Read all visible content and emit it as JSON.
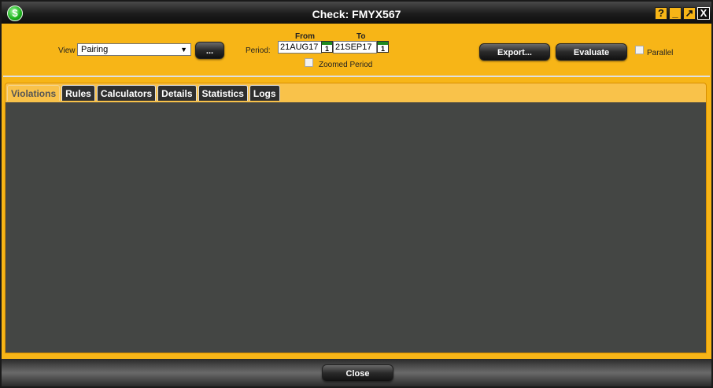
{
  "window": {
    "title": "Check: FMYX567",
    "app_icon": "dollar-icon",
    "controls": [
      "help-icon",
      "minimize-icon",
      "maximize-icon",
      "close-icon"
    ],
    "control_glyphs": {
      "help": "?",
      "minimize": "_",
      "maximize": "↗",
      "close": "X"
    }
  },
  "toolbar": {
    "view_label": "View",
    "view_value": "Pairing",
    "ellipsis_label": "...",
    "period_label": "Period:",
    "from_label": "From",
    "to_label": "To",
    "from_date": "21AUG17",
    "to_date": "21SEP17",
    "calendar_day": "1",
    "zoomed_period_label": "Zoomed Period",
    "export_label": "Export...",
    "evaluate_label": "Evaluate",
    "parallel_label": "Parallel"
  },
  "tabs": [
    {
      "label": "Violations",
      "active": true
    },
    {
      "label": "Rules"
    },
    {
      "label": "Calculators"
    },
    {
      "label": "Details"
    },
    {
      "label": "Statistics"
    },
    {
      "label": "Logs"
    }
  ],
  "footer": {
    "close_label": "Close"
  },
  "colors": {
    "accent": "#f7b517",
    "content_bg": "#444644",
    "titlebar": "#1c1c1c"
  }
}
